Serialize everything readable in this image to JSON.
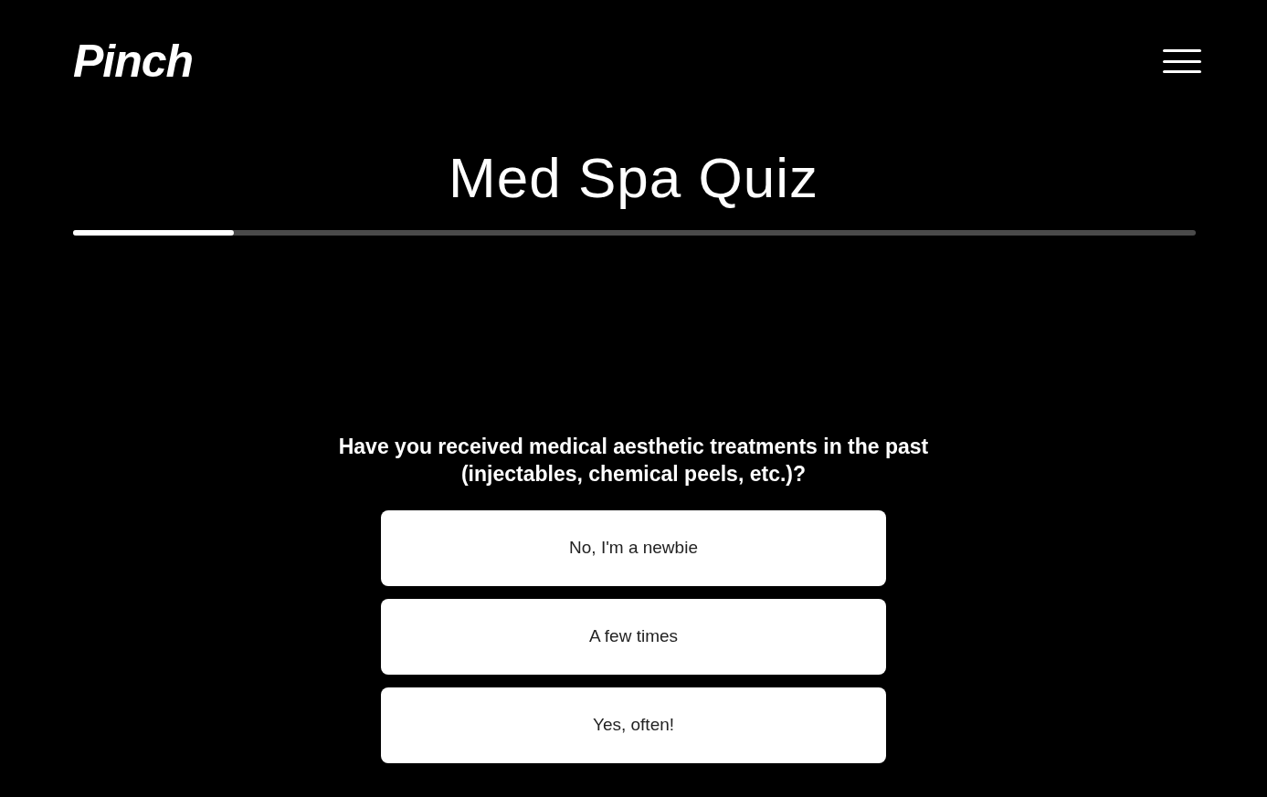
{
  "header": {
    "logo": "Pinch"
  },
  "title": "Med Spa Quiz",
  "progress": {
    "level": 0.143
  },
  "question": "Have you received medical aesthetic treatments in the past (injectables, chemical peels, etc.)?",
  "options": [
    {
      "label": "No, I'm a newbie"
    },
    {
      "label": "A few times"
    },
    {
      "label": "Yes, often!"
    }
  ]
}
